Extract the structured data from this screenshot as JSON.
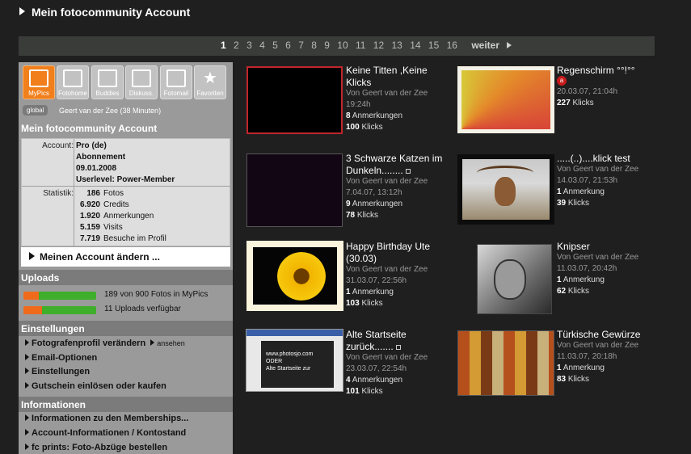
{
  "header": {
    "title": "Mein fotocommunity Account"
  },
  "pagination": {
    "pages": [
      "1",
      "2",
      "3",
      "4",
      "5",
      "6",
      "7",
      "8",
      "9",
      "10",
      "11",
      "12",
      "13",
      "14",
      "15",
      "16"
    ],
    "current": "1",
    "next_label": "weiter"
  },
  "sidebar": {
    "icons": [
      {
        "label": "MyPics",
        "icon": "pictures-icon"
      },
      {
        "label": "Fotohome",
        "icon": "fotohome-icon"
      },
      {
        "label": "Buddies",
        "icon": "buddies-icon"
      },
      {
        "label": "Diskuss.",
        "icon": "discussion-icon"
      },
      {
        "label": "Fotomail",
        "icon": "mail-icon"
      },
      {
        "label": "Favoriten",
        "icon": "star-icon"
      }
    ],
    "global_label": "global",
    "user_line": "Geert van der Zee (38 Minuten)",
    "account_title": "Mein fotocommunity Account",
    "account_key": "Account:",
    "account_values": [
      "Pro (de)",
      "Abonnement",
      "09.01.2008",
      "Userlevel: Power-Member"
    ],
    "stats_key": "Statistik:",
    "stats": [
      {
        "n": "186",
        "label": "Fotos"
      },
      {
        "n": "6.920",
        "label": "Credits"
      },
      {
        "n": "1.920",
        "label": "Anmerkungen"
      },
      {
        "n": "5.159",
        "label": "Visits"
      },
      {
        "n": "7.719",
        "label": "Besuche im Profil"
      }
    ],
    "change_account": "Meinen Account ändern ...",
    "uploads_title": "Uploads",
    "uploads": [
      {
        "text": "189 von 900 Fotos in MyPics",
        "fraction": 0.21
      },
      {
        "text": "11 Uploads verfügbar",
        "fraction": 0.25
      }
    ],
    "settings_title": "Einstellungen",
    "settings": [
      {
        "label": "Fotografenprofil verändern",
        "extra": "ansehen"
      },
      {
        "label": "Email-Optionen",
        "extra": ""
      },
      {
        "label": "Einstellungen",
        "extra": ""
      },
      {
        "label": "Gutschein einlösen oder kaufen",
        "extra": ""
      }
    ],
    "info_title": "Informationen",
    "info": [
      "Informationen zu den Memberships...",
      "Account-Informationen / Kontostand",
      "fc prints: Foto-Abzüge bestellen"
    ]
  },
  "photos": [
    {
      "title": "Keine Titten ,Keine Klicks",
      "by": "Von Geert van der Zee",
      "date": "19:24h",
      "notes": "8",
      "notes_label": "Anmerkungen",
      "clicks": "100",
      "clicks_label": "Klicks",
      "thumb": "black"
    },
    {
      "title": "Regenschirm °°!°°",
      "by": "",
      "date": "20.03.07, 21:04h",
      "notes": "",
      "notes_label": "",
      "clicks": "227",
      "clicks_label": "Klicks",
      "thumb": "umbrella",
      "badge": "a"
    },
    {
      "title": "3 Schwarze Katzen im Dunkeln........",
      "by": "Von Geert van der Zee",
      "date": "7.04.07, 13:12h",
      "notes": "9",
      "notes_label": "Anmerkungen",
      "clicks": "78",
      "clicks_label": "Klicks",
      "thumb": "dark"
    },
    {
      "title": ".....(..)....klick test",
      "by": "Von Geert van der Zee",
      "date": "14.03.07, 21:53h",
      "notes": "1",
      "notes_label": "Anmerkung",
      "clicks": "39",
      "clicks_label": "Klicks",
      "thumb": "deer"
    },
    {
      "title": "Happy Birthday Ute (30.03)",
      "by": "Von Geert van der Zee",
      "date": "31.03.07, 22:56h",
      "notes": "1",
      "notes_label": "Anmerkung",
      "clicks": "103",
      "clicks_label": "Klicks",
      "thumb": "flower"
    },
    {
      "title": "Knipser",
      "by": "Von Geert van der Zee",
      "date": "11.03.07, 20:42h",
      "notes": "1",
      "notes_label": "Anmerkung",
      "clicks": "62",
      "clicks_label": "Klicks",
      "thumb": "knipser"
    },
    {
      "title": "Alte Startseite zurück.......",
      "by": "Von Geert van der Zee",
      "date": "23.03.07, 22:54h",
      "notes": "4",
      "notes_label": "Anmerkungen",
      "clicks": "101",
      "clicks_label": "Klicks",
      "thumb": "screenshot"
    },
    {
      "title": "Türkische Gewürze",
      "by": "Von Geert van der Zee",
      "date": "11.03.07, 20:18h",
      "notes": "1",
      "notes_label": "Anmerkung",
      "clicks": "83",
      "clicks_label": "Klicks",
      "thumb": "spices"
    }
  ],
  "thumb_text": {
    "url": "www.photosjo.com",
    "oder": "ODER",
    "alte": "Alte Startseite zur"
  },
  "colors": {
    "accent": "#f07f1c",
    "selected_border": "#c0262c",
    "bar_green": "#3fae2a",
    "bar_orange": "#f06a1c"
  }
}
